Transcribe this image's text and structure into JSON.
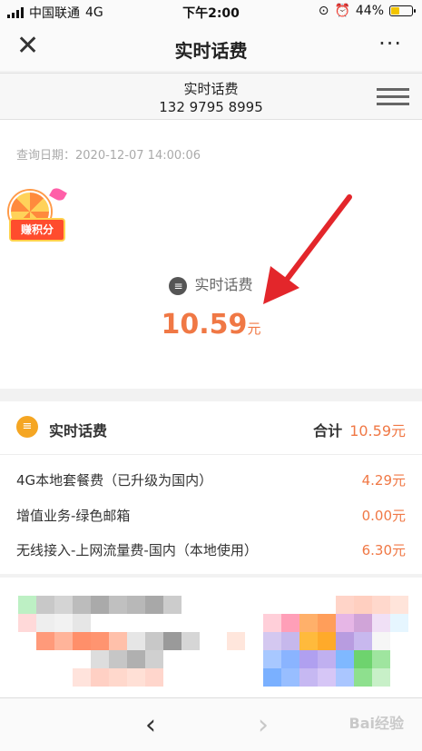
{
  "status_bar": {
    "carrier": "中国联通",
    "network": "4G",
    "time": "下午2:00",
    "battery": "44%",
    "battery_level": 0.44
  },
  "navbar": {
    "close_icon": "close-icon",
    "title": "实时话费",
    "more": "···"
  },
  "subheader": {
    "title": "实时话费",
    "phone": "132 9795 8995",
    "menu_icon": "list-menu-icon"
  },
  "summary": {
    "query_date": "查询日期：2020-12-07 14:00:06",
    "promo_badge": "赚积分",
    "label": "实时话费",
    "amount": "10.59",
    "unit": "元"
  },
  "detail": {
    "header_label": "实时话费",
    "total_label": "合计",
    "total_value": "10.59元",
    "items": [
      {
        "name": "4G本地套餐费（已升级为国内）",
        "value": "4.29元"
      },
      {
        "name": "增值业务-绿色邮箱",
        "value": "0.00元"
      },
      {
        "name": "无线接入-上网流量费-国内（本地使用）",
        "value": "6.30元"
      }
    ]
  },
  "bottom_bar": {
    "back": "‹",
    "forward": "›",
    "watermark": "Bai经验"
  },
  "colors": {
    "accent": "#f07845",
    "arrow": "#e3262b",
    "icon_orange": "#f5a623"
  }
}
